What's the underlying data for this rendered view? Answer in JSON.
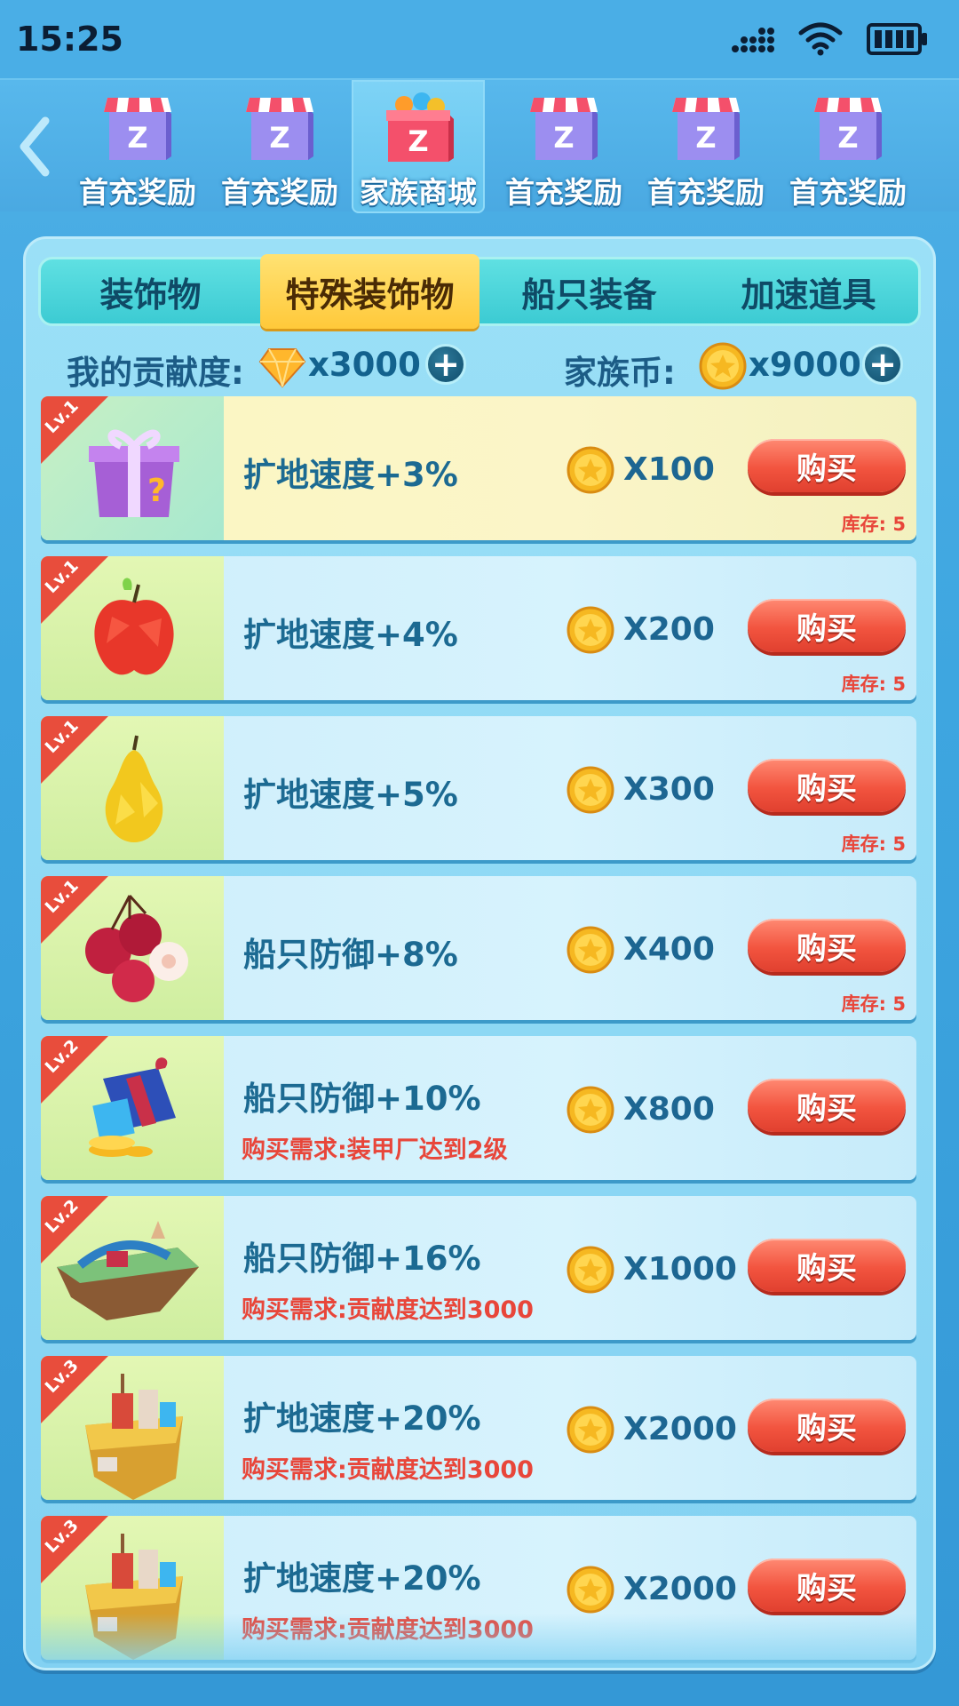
{
  "status_bar": {
    "time": "15:25"
  },
  "nav": {
    "tabs": [
      {
        "label": "首充奖励",
        "active": false
      },
      {
        "label": "首充奖励",
        "active": false
      },
      {
        "label": "家族商城",
        "active": true
      },
      {
        "label": "首充奖励",
        "active": false
      },
      {
        "label": "首充奖励",
        "active": false
      },
      {
        "label": "首充奖励",
        "active": false
      }
    ]
  },
  "categories": {
    "tabs": [
      {
        "label": "装饰物",
        "active": false
      },
      {
        "label": "特殊装饰物",
        "active": true
      },
      {
        "label": "船只装备",
        "active": false
      },
      {
        "label": "加速道具",
        "active": false
      }
    ]
  },
  "balance": {
    "contribution_label": "我的贡献度:",
    "contribution_value": "x3000",
    "family_coin_label": "家族币:",
    "family_coin_value": "x9000"
  },
  "buy_label": "购买",
  "items": [
    {
      "level": "Lv.1",
      "desc": "扩地速度+3%",
      "price": "X100",
      "stock": "库存: 5",
      "requirement": "",
      "icon": "gift-box-icon"
    },
    {
      "level": "Lv.1",
      "desc": "扩地速度+4%",
      "price": "X200",
      "stock": "库存: 5",
      "requirement": "",
      "icon": "apple-icon"
    },
    {
      "level": "Lv.1",
      "desc": "扩地速度+5%",
      "price": "X300",
      "stock": "库存: 5",
      "requirement": "",
      "icon": "pear-icon"
    },
    {
      "level": "Lv.1",
      "desc": "船只防御+8%",
      "price": "X400",
      "stock": "库存: 5",
      "requirement": "",
      "icon": "lychee-icon"
    },
    {
      "level": "Lv.2",
      "desc": "船只防御+10%",
      "price": "X800",
      "stock": "",
      "requirement": "购买需求:装甲厂达到2级",
      "icon": "treasure-gift-icon"
    },
    {
      "level": "Lv.2",
      "desc": "船只防御+16%",
      "price": "X1000",
      "stock": "",
      "requirement": "购买需求:贡献度达到3000",
      "icon": "floating-island-icon"
    },
    {
      "level": "Lv.3",
      "desc": "扩地速度+20%",
      "price": "X2000",
      "stock": "",
      "requirement": "购买需求:贡献度达到3000",
      "icon": "city-island-icon"
    },
    {
      "level": "Lv.3",
      "desc": "扩地速度+20%",
      "price": "X2000",
      "stock": "",
      "requirement": "购买需求:贡献度达到3000",
      "icon": "city-island-icon"
    }
  ],
  "colors": {
    "background": "#3ea6e0",
    "buy_button": "#f2543f",
    "requirement_text": "#e8463a",
    "active_category": "#ffc93a"
  }
}
